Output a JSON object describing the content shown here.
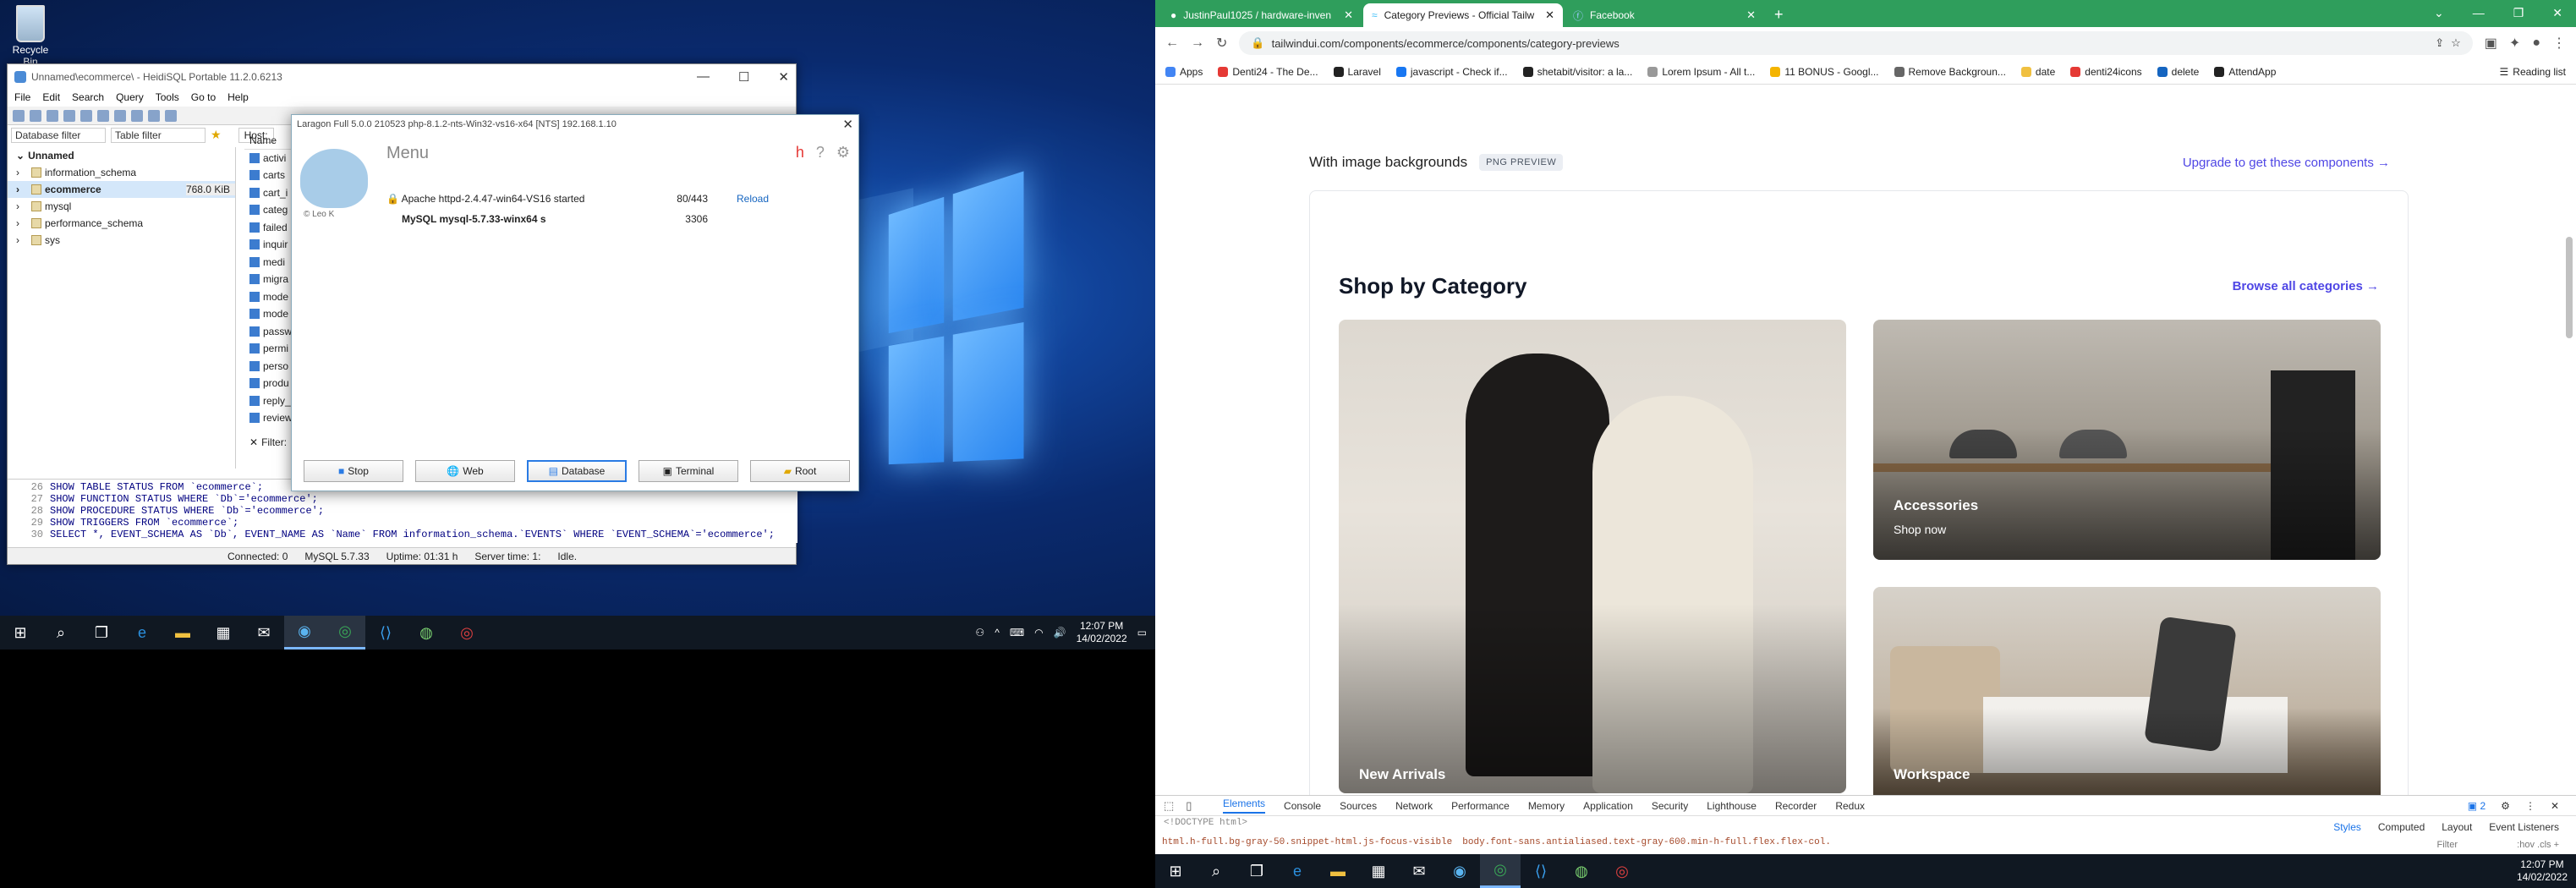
{
  "desktop": {
    "recycle_bin": "Recycle Bin"
  },
  "heidi": {
    "title": "Unnamed\\ecommerce\\ - HeidiSQL Portable 11.2.0.6213",
    "menu": [
      "File",
      "Edit",
      "Search",
      "Query",
      "Tools",
      "Go to",
      "Help"
    ],
    "db_filter": "Database filter",
    "table_filter": "Table filter",
    "host_label": "Host:",
    "filter_label": "Filter:",
    "tree": {
      "root": "Unnamed",
      "items": [
        {
          "name": "information_schema",
          "size": ""
        },
        {
          "name": "ecommerce",
          "size": "768.0 KiB"
        },
        {
          "name": "mysql",
          "size": ""
        },
        {
          "name": "performance_schema",
          "size": ""
        },
        {
          "name": "sys",
          "size": ""
        }
      ]
    },
    "tables_header": "Name",
    "tables": [
      "activi",
      "carts",
      "cart_i",
      "categ",
      "failed",
      "inquir",
      "medi",
      "migra",
      "mode",
      "mode",
      "passw",
      "permi",
      "perso",
      "produ",
      "reply_",
      "review"
    ],
    "sql_lines": [
      {
        "n": "26",
        "text": "SHOW TABLE STATUS FROM `ecommerce`;"
      },
      {
        "n": "27",
        "text": "SHOW FUNCTION STATUS WHERE `Db`='ecommerce';"
      },
      {
        "n": "28",
        "text": "SHOW PROCEDURE STATUS WHERE `Db`='ecommerce';"
      },
      {
        "n": "29",
        "text": "SHOW TRIGGERS FROM `ecommerce`;"
      },
      {
        "n": "30",
        "text": "SELECT *, EVENT_SCHEMA AS `Db`, EVENT_NAME AS `Name` FROM information_schema.`EVENTS` WHERE `EVENT_SCHEMA`='ecommerce';"
      }
    ],
    "status": {
      "connected": "Connected: 0",
      "server": "MySQL 5.7.33",
      "uptime": "Uptime: 01:31 h",
      "server_time": "Server time: 1:",
      "idle": "Idle."
    }
  },
  "laragon": {
    "title": "Laragon Full 5.0.0 210523 php-8.1.2-nts-Win32-vs16-x64 [NTS]  192.168.1.10",
    "menu_label": "Menu",
    "author": "© Leo K",
    "services": [
      {
        "name": "Apache httpd-2.4.47-win64-VS16 started",
        "port": "80/443",
        "action": "Reload"
      },
      {
        "name": "MySQL mysql-5.7.33-winx64 s",
        "port": "3306",
        "action": ""
      }
    ],
    "buttons": [
      "Stop",
      "Web",
      "Database",
      "Terminal",
      "Root"
    ]
  },
  "taskbar_left": {
    "time": "12:07 PM",
    "date": "14/02/2022"
  },
  "browser": {
    "tabs": [
      {
        "title": "JustinPaul1025 / hardware-inven",
        "active": false
      },
      {
        "title": "Category Previews - Official Tailw",
        "active": true
      },
      {
        "title": "Facebook",
        "active": false
      }
    ],
    "url": "tailwindui.com/components/ecommerce/components/category-previews",
    "bookmarks": [
      "Apps",
      "Denti24 - The De...",
      "Laravel",
      "javascript - Check if...",
      "shetabit/visitor: a la...",
      "Lorem Ipsum - All t...",
      "11 BONUS - Googl...",
      "Remove Backgroun...",
      "date",
      "denti24icons",
      "delete",
      "AttendApp"
    ],
    "reading_list": "Reading list"
  },
  "page": {
    "section_title": "With image backgrounds",
    "badge": "PNG PREVIEW",
    "upgrade": "Upgrade to get these components →",
    "shop_title": "Shop by Category",
    "browse": "Browse all categories →",
    "cards": [
      {
        "label": "New Arrivals",
        "sub": ""
      },
      {
        "label": "Accessories",
        "sub": "Shop now"
      },
      {
        "label": "Workspace",
        "sub": ""
      }
    ]
  },
  "devtools": {
    "tabs": [
      "Elements",
      "Console",
      "Sources",
      "Network",
      "Performance",
      "Memory",
      "Application",
      "Security",
      "Lighthouse",
      "Recorder",
      "Redux"
    ],
    "issues": "2",
    "doctype": "<!DOCTYPE html>",
    "crumbs": [
      "html.h-full.bg-gray-50.snippet-html.js-focus-visible",
      "body.font-sans.antialiased.text-gray-600.min-h-full.flex.flex-col."
    ],
    "side_tabs": [
      "Styles",
      "Computed",
      "Layout",
      "Event Listeners"
    ],
    "filter": "Filter",
    "filter_hints": ":hov .cls +"
  },
  "taskbar_right": {
    "time": "12:07 PM",
    "date": "14/02/2022"
  }
}
